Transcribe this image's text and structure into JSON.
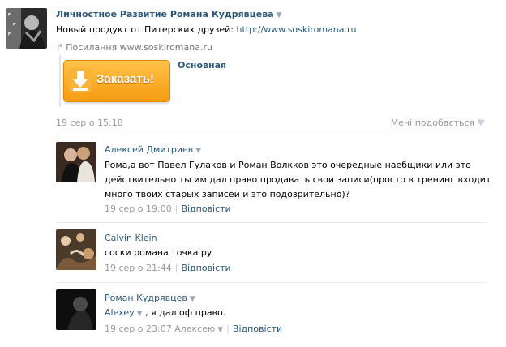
{
  "post": {
    "author": "Личностное Развитие Романа Кудрявцева",
    "text_prefix": "Новый продукт от Питерских друзей: ",
    "text_link": "http://www.soskiromana.ru",
    "share_label": "Посилання ",
    "share_domain": "www.soskiromana.ru",
    "button_label": "Заказать!",
    "attach_title": "Основная",
    "date": "19 сер о 15:18",
    "likes_label": "Мені подобається",
    "dropdown_glyph": "▼",
    "heart_glyph": "♥",
    "share_glyph": "↱"
  },
  "comments": [
    {
      "name": "Алексей Дмитриев",
      "text": "Рома,а вот Павел Гулаков и Роман Волкков это очередные наебщики или это действительно ты им дал право продавать свои записи(просто в тренинг входит много твоих старых записей и это подозрительно)?",
      "date": "19 сер о 19:00",
      "reply": "Відповісти"
    },
    {
      "name": "Calvin Klein",
      "text": "соски романа точка ру",
      "date": "19 сер о 21:44",
      "reply": "Відповісти"
    },
    {
      "name": "Роман Кудрявцев",
      "mention": "Alexey",
      "text_after": ", я дал оф право.",
      "date": "19 сер о 23:07",
      "addressed": "Алексею",
      "reply": "Відповісти"
    }
  ]
}
